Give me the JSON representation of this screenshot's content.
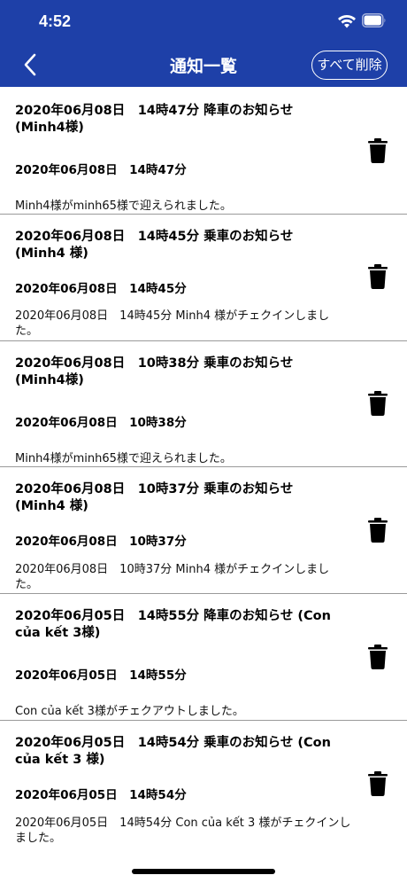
{
  "status_bar": {
    "time": "4:52"
  },
  "header": {
    "title": "通知一覧",
    "delete_all_label": "すべて削除"
  },
  "notifications": [
    {
      "title": "2020年06月08日　14時47分 降車のお知らせ (Minh4様)",
      "datetime": "2020年06月08日　14時47分",
      "message": "Minh4様がminh65様で迎えられました。"
    },
    {
      "title": "2020年06月08日　14時45分 乗車のお知らせ (Minh4 様)",
      "datetime": "2020年06月08日　14時45分",
      "message": "2020年06月08日　14時45分 Minh4 様がチェクインしました。"
    },
    {
      "title": "2020年06月08日　10時38分 乗車のお知らせ (Minh4様)",
      "datetime": "2020年06月08日　10時38分",
      "message": "Minh4様がminh65様で迎えられました。"
    },
    {
      "title": "2020年06月08日　10時37分 乗車のお知らせ (Minh4 様)",
      "datetime": "2020年06月08日　10時37分",
      "message": "2020年06月08日　10時37分 Minh4 様がチェクインしました。"
    },
    {
      "title": "2020年06月05日　14時55分 降車のお知らせ (Con của kết 3様)",
      "datetime": "2020年06月05日　14時55分",
      "message": "Con của kết 3様がチェクアウトしました。"
    },
    {
      "title": "2020年06月05日　14時54分 乗車のお知らせ (Con của kết 3 様)",
      "datetime": "2020年06月05日　14時54分",
      "message": "2020年06月05日　14時54分 Con của kết 3 様がチェクインしました。"
    }
  ]
}
